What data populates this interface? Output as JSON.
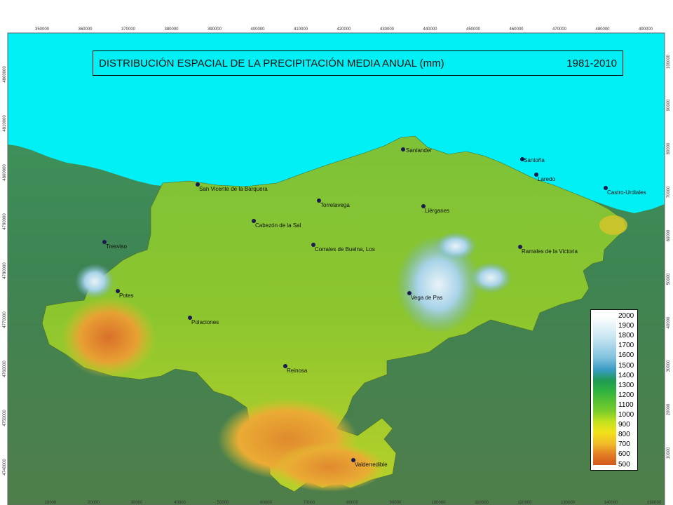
{
  "title": {
    "main": "DISTRIBUCIÓN ESPACIAL DE LA PRECIPITACIÓN MEDIA ANUAL (mm)",
    "period": "1981-2010"
  },
  "legend": {
    "values": [
      "2000",
      "1900",
      "1800",
      "1700",
      "1600",
      "1500",
      "1400",
      "1300",
      "1200",
      "1100",
      "1000",
      "900",
      "800",
      "700",
      "600",
      "500"
    ]
  },
  "axes": {
    "top_ticks": [
      "350000",
      "360000",
      "370000",
      "380000",
      "390000",
      "400000",
      "410000",
      "420000",
      "430000",
      "440000",
      "450000",
      "460000",
      "470000",
      "480000",
      "490000"
    ],
    "bottom_ticks": [
      "10000",
      "20000",
      "30000",
      "40000",
      "50000",
      "60000",
      "70000",
      "80000",
      "90000",
      "100000",
      "110000",
      "120000",
      "130000",
      "140000",
      "150000"
    ],
    "left_ticks": [
      "4800000",
      "4810000",
      "4800000",
      "4790000",
      "4780000",
      "4770000",
      "4760000",
      "4750000",
      "4740000"
    ],
    "right_ticks": [
      "100000",
      "90000",
      "80000",
      "70000",
      "60000",
      "50000",
      "40000",
      "30000",
      "20000",
      "10000"
    ]
  },
  "towns": [
    {
      "name": "Santander"
    },
    {
      "name": "Santoña"
    },
    {
      "name": "Laredo"
    },
    {
      "name": "Castro-Urdiales"
    },
    {
      "name": "San Vicente de la Barquera"
    },
    {
      "name": "Torrelavega"
    },
    {
      "name": "Liérganes"
    },
    {
      "name": "Cabezón de la Sal"
    },
    {
      "name": "Corrales de Buelna, Los"
    },
    {
      "name": "Ramales de la Victoria"
    },
    {
      "name": "Tresviso"
    },
    {
      "name": "Potes"
    },
    {
      "name": "Vega de Pas"
    },
    {
      "name": "Polaciones"
    },
    {
      "name": "Reinosa"
    },
    {
      "name": "Valderredible"
    }
  ],
  "colors": {
    "sea": "#00f0f5",
    "land_outside": "#3f8a55",
    "region_green": "#7ec02f",
    "region_yellow": "#c8d828",
    "region_orange": "#e58f2c",
    "region_blue": "#8fc8e0",
    "town_dot": "#1a1a50"
  }
}
